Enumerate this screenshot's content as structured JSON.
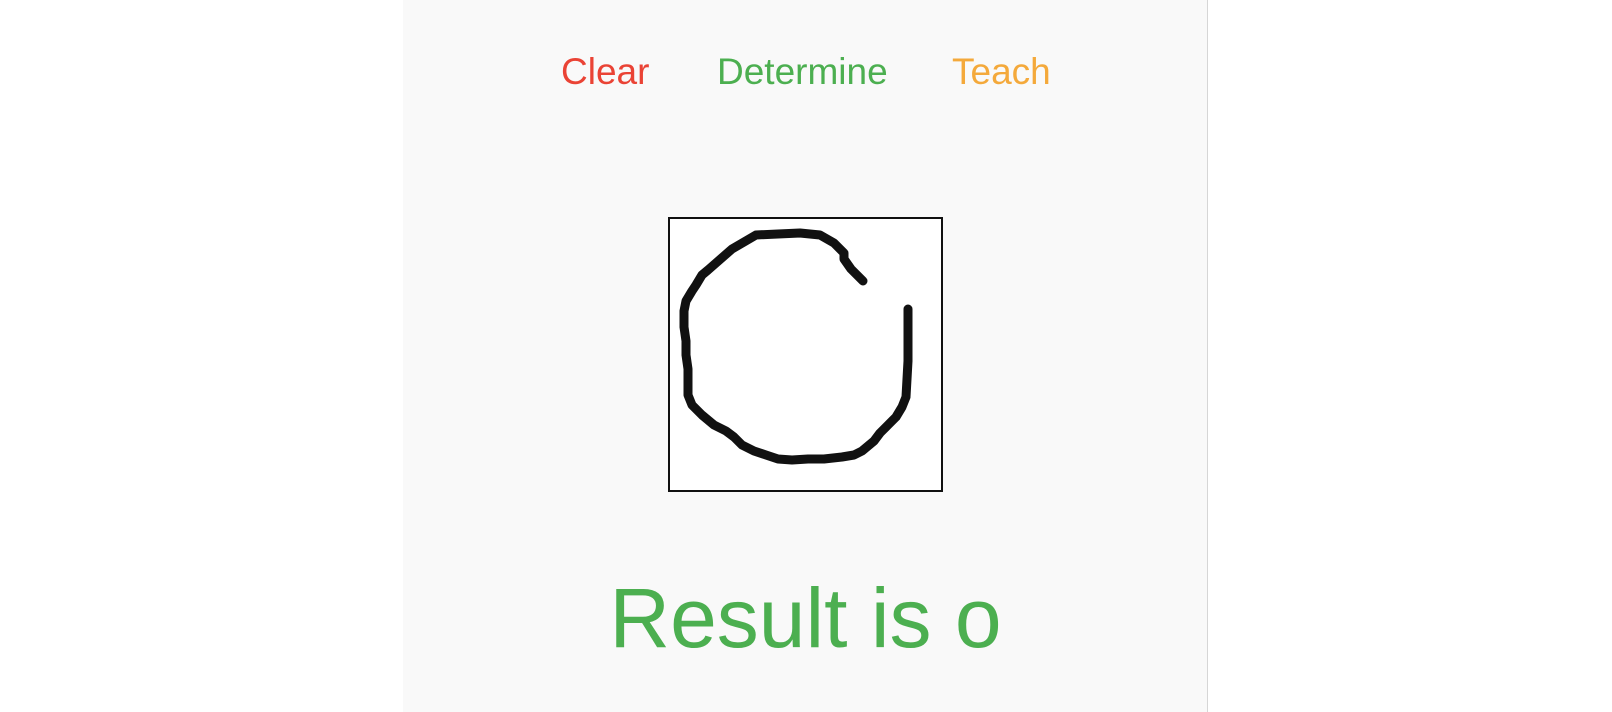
{
  "toolbar": {
    "clear_label": "Clear",
    "determine_label": "Determine",
    "teach_label": "Teach"
  },
  "colors": {
    "clear": "#ea4335",
    "determine": "#4caf50",
    "teach": "#f4a93b",
    "result": "#4caf50",
    "stroke": "#111111"
  },
  "drawing_canvas": {
    "content": "hand-drawn circle stroke"
  },
  "result": {
    "text": "Result is o"
  }
}
